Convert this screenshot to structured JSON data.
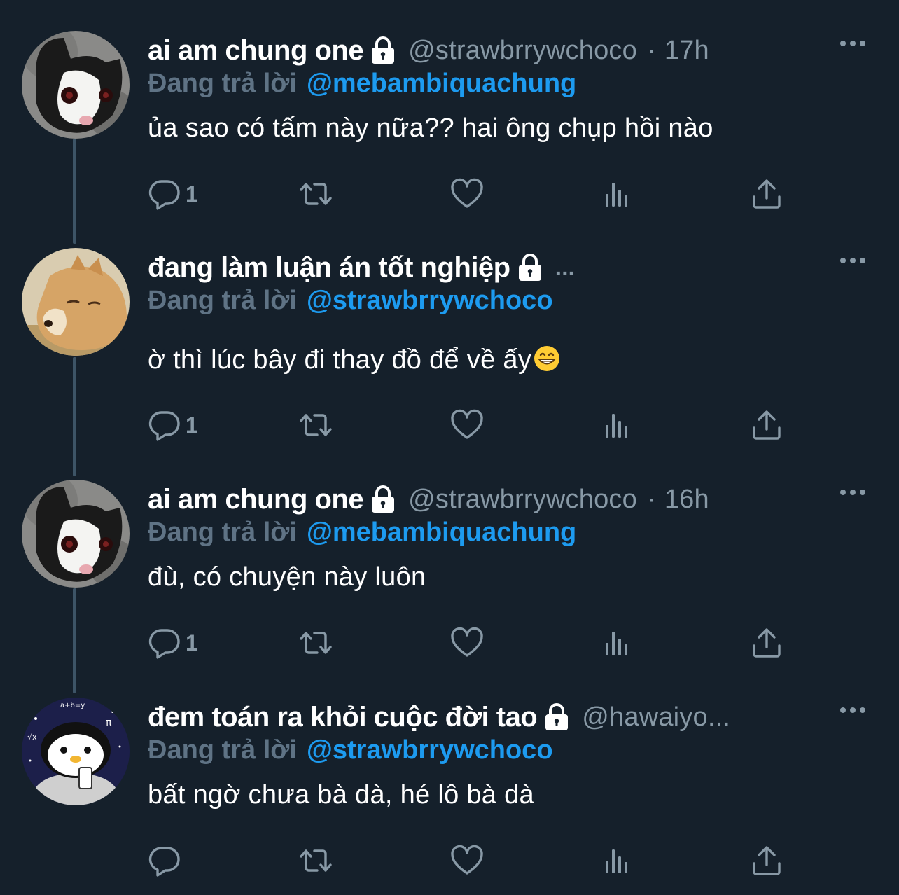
{
  "tweets": [
    {
      "display_name": "ai am chung one",
      "handle": "@strawbrrywchoco",
      "time": "17h",
      "separator": "·",
      "reply_label": "Đang trả lời",
      "reply_target": "@mebambiquachung",
      "text": "ủa sao có tấm này nữa?? hai ông chụp hồi nào",
      "reply_count": "1",
      "avatar": "cat-avatar"
    },
    {
      "display_name": "đang làm luận án tốt nghiệp",
      "handle": "...",
      "reply_label": "Đang trả lời",
      "reply_target": "@strawbrrywchoco",
      "text": "ờ thì lúc bây đi thay đồ để về ấy",
      "reply_count": "1",
      "avatar": "shiba-dog-avatar"
    },
    {
      "display_name": "ai am chung one",
      "handle": "@strawbrrywchoco",
      "time": "16h",
      "separator": "·",
      "reply_label": "Đang trả lời",
      "reply_target": "@mebambiquachung",
      "text": "đù, có chuyện này luôn",
      "reply_count": "1",
      "avatar": "cat-avatar"
    },
    {
      "display_name": "đem toán ra khỏi cuộc đời tao",
      "handle": "@hawaiyo...",
      "reply_label": "Đang trả lời",
      "reply_target": "@strawbrrywchoco",
      "text": "bất ngờ chưa bà dà, hé lô bà dà",
      "reply_count": "",
      "avatar": "penguin-math-avatar"
    }
  ],
  "icons": {
    "lock": "lock-icon",
    "more": "more-icon",
    "reply": "reply-icon",
    "retweet": "retweet-icon",
    "like": "like-icon",
    "views": "views-icon",
    "share": "share-icon",
    "grin_emoji": "grinning-face-emoji"
  },
  "colors": {
    "background": "#15202b",
    "accent": "#1d9bf0",
    "secondary_text": "#8899a6",
    "reply_label": "#5f7385",
    "thread_line": "#3d5466"
  }
}
